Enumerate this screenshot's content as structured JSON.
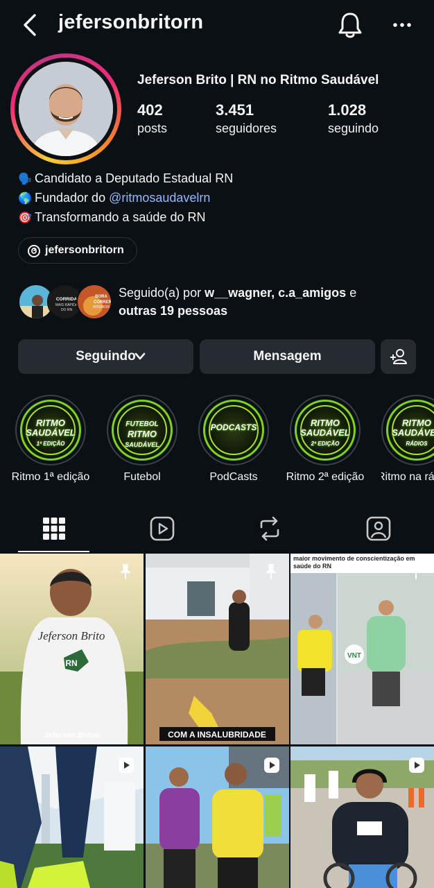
{
  "header": {
    "username": "jefersonbritorn"
  },
  "profile": {
    "display_name": "Jeferson Brito | RN no Ritmo Saudável",
    "stats": [
      {
        "value": "402",
        "label": "posts"
      },
      {
        "value": "3.451",
        "label": "seguidores"
      },
      {
        "value": "1.028",
        "label": "seguindo"
      }
    ],
    "bio": {
      "line1": "Candidato a Deputado Estadual RN",
      "line2_prefix": "Fundador do ",
      "line2_link": "@ritmosaudavelrn",
      "line3": "Transformando a saúde do RN",
      "emoji1": "🗣️",
      "emoji2": "🌎",
      "emoji3": "🎯"
    },
    "threads_handle": "jefersonbritorn",
    "followed_by": {
      "prefix": "Seguido(a) por ",
      "names": "w__wagner, c.a_amigos",
      "joiner": " e",
      "others": "outras 19 pessoas",
      "mini_av_texts": [
        "CORRIDA MAIS RÁPIDA DO RN",
        "BORA CORRER INTERIOR"
      ]
    }
  },
  "actions": {
    "following": "Seguindo",
    "message": "Mensagem"
  },
  "highlights": [
    {
      "label": "Ritmo 1ª edição",
      "badge_line1": "RITMO",
      "badge_line2": "SAUDÁVEL",
      "badge_line3": "1ª EDIÇÃO"
    },
    {
      "label": "Futebol",
      "badge_line1": "FUTEBOL",
      "badge_line2": "RITMO",
      "badge_line3": "SAUDÁVEL"
    },
    {
      "label": "PodCasts",
      "badge_line1": "",
      "badge_line2": "PODCASTS",
      "badge_line3": ""
    },
    {
      "label": "Ritmo 2ª edição",
      "badge_line1": "RITMO",
      "badge_line2": "SAUDÁVEL",
      "badge_line3": "2ª EDIÇÃO"
    },
    {
      "label": "Ritmo na rá",
      "badge_line1": "RITMO",
      "badge_line2": "SAUDÁVEL",
      "badge_line3": "RÁDIOS"
    }
  ],
  "posts": [
    {
      "caption": "",
      "shirt_text": "Jeferson Brito",
      "shirt_badge": "RN",
      "footer": "Jeferson Britoo"
    },
    {
      "caption": "COM A INSALUBRIDADE"
    },
    {
      "caption": "maior movimento de conscientização em saúde do RN",
      "race_logo": "VNT"
    },
    {
      "caption": ""
    },
    {
      "caption": ""
    },
    {
      "caption": ""
    }
  ],
  "colors": {
    "background": "#0b1014",
    "button": "#262b31",
    "link": "#93b8ff",
    "highlight_green": "#7ed321"
  }
}
